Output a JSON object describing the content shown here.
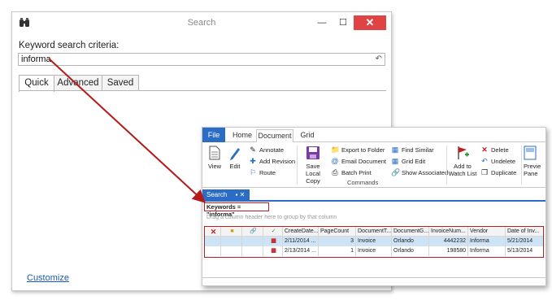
{
  "dialog": {
    "title": "Search",
    "min_label": "—",
    "max_label": "☐",
    "close_label": "✕",
    "keyword_label": "Keyword search criteria:",
    "keyword_value": "informa",
    "undo_glyph": "↶",
    "tabs": [
      {
        "label": "Quick"
      },
      {
        "label": "Advanced"
      },
      {
        "label": "Saved"
      }
    ],
    "customize_label": "Customize"
  },
  "ribbon": {
    "tabs": [
      {
        "label": "File"
      },
      {
        "label": "Home"
      },
      {
        "label": "Document"
      },
      {
        "label": "Grid"
      }
    ],
    "view_label": "View",
    "edit_label": "Edit",
    "annotate_label": "Annotate",
    "add_revision_label": "Add Revision",
    "route_label": "Route",
    "save_local_copy_label": "Save Local Copy",
    "export_to_folder_label": "Export to Folder",
    "email_document_label": "Email Document",
    "batch_print_label": "Batch Print",
    "commands_group_label": "Commands",
    "find_similar_label": "Find Similar",
    "grid_edit_label": "Grid Edit",
    "show_associated_label": "Show Associated",
    "add_to_watch_list_label": "Add to Watch List",
    "delete_label": "Delete",
    "undelete_label": "Undelete",
    "duplicate_label": "Duplicate",
    "preview_pane_label": "Previe Pane"
  },
  "results": {
    "panel_tab_label": "Search",
    "panel_tab_controls": "▪ ✕",
    "keywords_text": "Keywords = \"informa\"",
    "group_hint": "Drag a column header here to group by that column",
    "columns": [
      "CreateDate...",
      "PageCount",
      "DocumentT...",
      "DocumentG...",
      "InvoiceNum...",
      "Vendor",
      "Date of Inv..."
    ],
    "rows": [
      {
        "create_date": "2/11/2014 ...",
        "page_count": "3",
        "doc_type": "Invoice",
        "doc_group": "Orlando",
        "invoice_num": "4442232",
        "vendor": "Informa",
        "invoice_date": "5/21/2014"
      },
      {
        "create_date": "2/13/2014 ...",
        "page_count": "1",
        "doc_type": "Invoice",
        "doc_group": "Orlando",
        "invoice_num": "198580",
        "vendor": "Informa",
        "invoice_date": "5/13/2014"
      }
    ]
  },
  "colors": {
    "accent_blue": "#2b6cc4",
    "highlight_red": "#c21d1d",
    "close_red": "#e04343",
    "selected_row": "#cfe3f7"
  }
}
